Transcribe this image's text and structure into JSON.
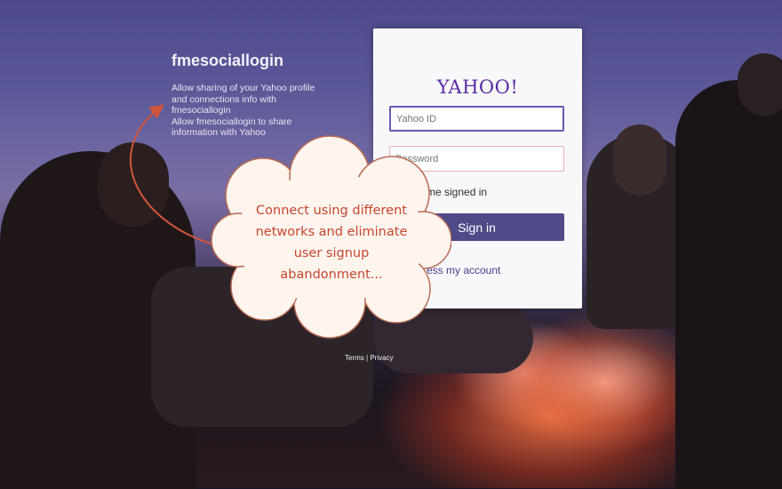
{
  "app": {
    "name": "fmesociallogin",
    "description": "Allow sharing of your Yahoo profile\nand connections info with\nfmesociallogin\nAllow fmesociallogin to share\ninformation with Yahoo"
  },
  "login": {
    "logo": "YAHOO!",
    "username_placeholder": "Yahoo ID",
    "password_placeholder": "Password",
    "keep_signed_in": "me signed in",
    "signin_label": "Sign in",
    "trouble_link": "ess my account"
  },
  "footer": {
    "terms": "Terms",
    "separator": "|",
    "privacy": "Privacy"
  },
  "callout": {
    "lines": [
      "Connect using different",
      "networks and eliminate",
      "user signup",
      "abandonment..."
    ]
  },
  "colors": {
    "brand": "#5d2ba3",
    "button": "#4f4b88",
    "callout_text": "#c5472f",
    "arrow": "#d0553a"
  }
}
